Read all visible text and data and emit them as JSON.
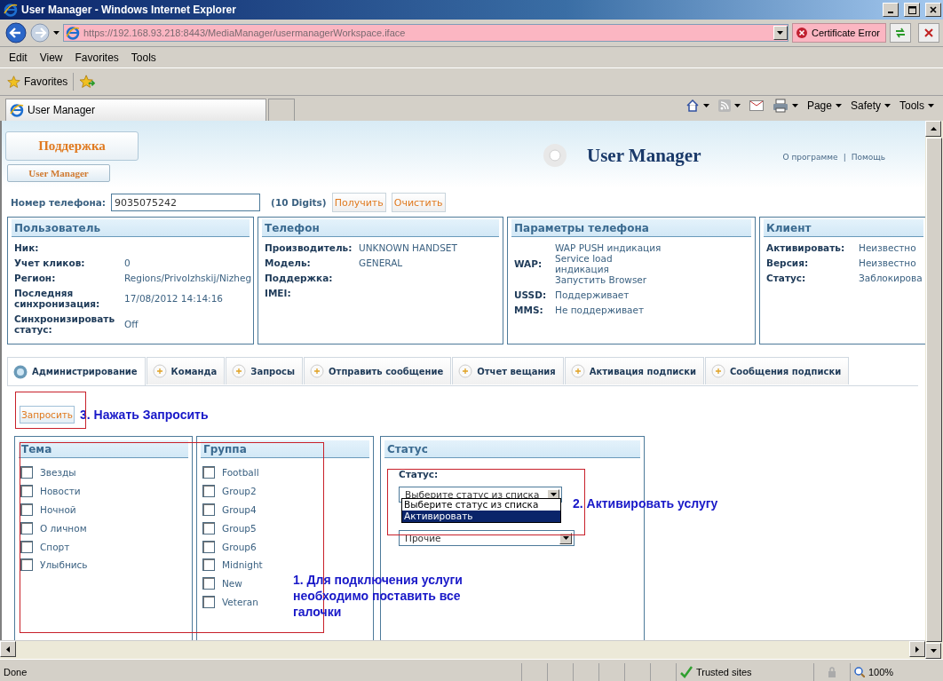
{
  "window": {
    "title": "User Manager - Windows Internet Explorer"
  },
  "address_bar": {
    "url": "https://192.168.93.218:8443/MediaManager/usermanagerWorkspace.iface",
    "certificate": "Certificate Error"
  },
  "menu": [
    "Edit",
    "View",
    "Favorites",
    "Tools"
  ],
  "favorites_bar": {
    "label": "Favorites"
  },
  "browser_tabs": [
    {
      "label": "User Manager",
      "selected": true
    }
  ],
  "command_bar": [
    "Page",
    "Safety",
    "Tools"
  ],
  "page": {
    "logo": "Поддержка",
    "app_button": "User Manager",
    "title": "User Manager",
    "links": [
      "О программе",
      "Помощь"
    ],
    "link_separator": "|",
    "phone": {
      "label": "Номер телефона:",
      "value": "9035075242",
      "hint": "(10 Digits)",
      "buttons": [
        "Получить",
        "Очистить"
      ]
    },
    "panels": [
      {
        "title": "Пользователь",
        "rows": [
          {
            "label": "Ник:"
          },
          {
            "label": "Учет кликов:",
            "values": [
              "0"
            ]
          },
          {
            "label": "Регион:",
            "values": [
              "Regions/Privolzhskij/Nizheg"
            ]
          },
          {
            "label": "Последняя синхронизация:",
            "values": [
              "17/08/2012 14:14:16"
            ]
          },
          {
            "label": "Синхронизировать статус:",
            "values": [
              "Off"
            ]
          }
        ]
      },
      {
        "title": "Телефон",
        "rows": [
          {
            "label": "Производитель:",
            "values": [
              "UNKNOWN HANDSET"
            ]
          },
          {
            "label": "Модель:",
            "values": [
              "GENERAL"
            ]
          },
          {
            "label": "Поддержка:"
          },
          {
            "label": "IMEI:"
          }
        ]
      },
      {
        "title": "Параметры телефона",
        "rows": [
          {
            "label": "WAP:",
            "values": [
              "WAP PUSH индикация",
              "Service load индикация",
              "Запустить Browser"
            ]
          },
          {
            "label": "USSD:",
            "values": [
              "Поддерживает"
            ]
          },
          {
            "label": "MMS:",
            "values": [
              "Не поддерживает"
            ]
          }
        ]
      },
      {
        "title": "Клиент",
        "rows": [
          {
            "label": "Активировать:",
            "values": [
              "Неизвестно"
            ]
          },
          {
            "label": "Версия:",
            "values": [
              "Неизвестно"
            ]
          },
          {
            "label": "Статус:",
            "values": [
              "Заблокирова"
            ]
          }
        ]
      }
    ],
    "tabs": [
      {
        "label": "Администрирование",
        "selected": true
      },
      {
        "label": "Команда",
        "selected": false
      },
      {
        "label": "Запросы",
        "selected": false
      },
      {
        "label": "Отправить сообщение",
        "selected": false
      },
      {
        "label": "Отчет вещания",
        "selected": false
      },
      {
        "label": "Активация подписки",
        "selected": false
      },
      {
        "label": "Сообщения подписки",
        "selected": false
      }
    ],
    "query_button": "Запросить",
    "topics": {
      "title": "Тема",
      "items": [
        {
          "label": "Звезды",
          "checked": false
        },
        {
          "label": "Новости",
          "checked": false
        },
        {
          "label": "Ночной",
          "checked": false
        },
        {
          "label": "О личном",
          "checked": false
        },
        {
          "label": "Спорт",
          "checked": false
        },
        {
          "label": "Улыбнись",
          "checked": false
        }
      ]
    },
    "groups": {
      "title": "Группа",
      "items": [
        {
          "label": "Football",
          "checked": false
        },
        {
          "label": "Group2",
          "checked": false
        },
        {
          "label": "Group4",
          "checked": false
        },
        {
          "label": "Group5",
          "checked": false
        },
        {
          "label": "Group6",
          "checked": false
        },
        {
          "label": "Midnight",
          "checked": false
        },
        {
          "label": "New",
          "checked": false
        },
        {
          "label": "Veteran",
          "checked": false
        }
      ]
    },
    "status": {
      "title": "Статус",
      "label": "Статус:",
      "select": "Выберите статус из списка",
      "options": [
        {
          "label": "Выберите статус из списка",
          "selected": false
        },
        {
          "label": "Активировать",
          "selected": true
        }
      ],
      "select2": "Прочие"
    }
  },
  "annotations": [
    "3. Нажать Запросить",
    "2. Активировать услугу",
    "1. Для подключения услуги необходимо поставить все галочки"
  ],
  "status_bar": {
    "text": "Done",
    "zone": "Trusted sites",
    "zoom": "100%"
  }
}
